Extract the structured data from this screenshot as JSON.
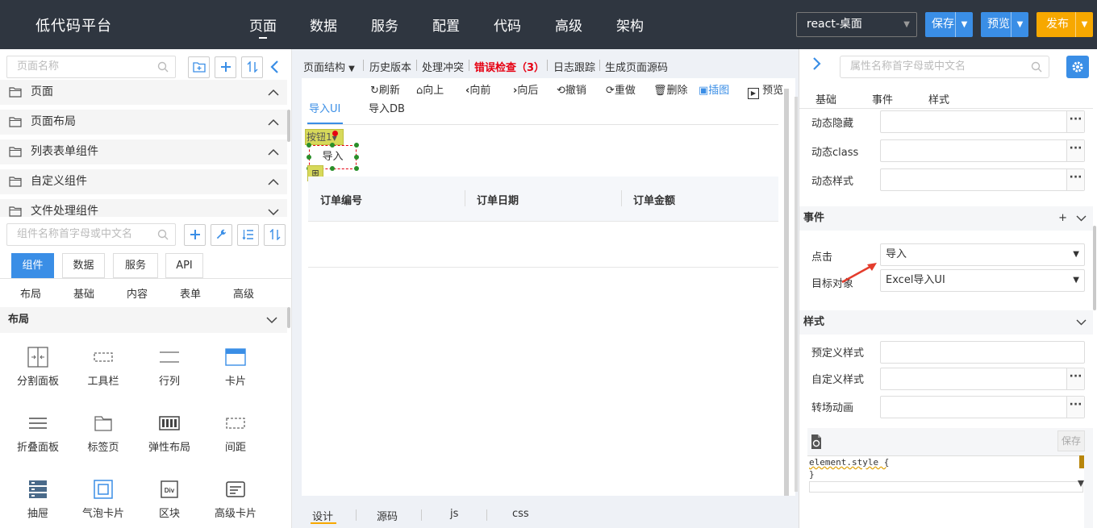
{
  "app": {
    "title": "低代码平台"
  },
  "nav": [
    "页面",
    "数据",
    "服务",
    "配置",
    "代码",
    "高级",
    "架构"
  ],
  "env_select": "react-桌面",
  "buttons": {
    "save": "保存",
    "preview": "预览",
    "publish": "发布"
  },
  "colors": {
    "topbar": "#2f3640",
    "accent": "#3a8ee6",
    "publish": "#f7a800",
    "error": "#e60012",
    "arrow": "#e43c2c"
  },
  "left": {
    "page_search_placeholder": "页面名称",
    "categories": [
      "页面",
      "页面布局",
      "列表表单组件",
      "自定义组件",
      "文件处理组件"
    ],
    "comp_search_placeholder": "组件名称首字母或中文名",
    "tabs": [
      "组件",
      "数据",
      "服务",
      "API"
    ],
    "subtabs": [
      "布局",
      "基础",
      "内容",
      "表单",
      "高级"
    ],
    "section_title": "布局",
    "components": [
      {
        "label": "分割面板",
        "icon": "split-panel-icon"
      },
      {
        "label": "工具栏",
        "icon": "toolbar-icon"
      },
      {
        "label": "行列",
        "icon": "row-col-icon"
      },
      {
        "label": "卡片",
        "icon": "card-icon"
      },
      {
        "label": "折叠面板",
        "icon": "collapse-icon"
      },
      {
        "label": "标签页",
        "icon": "tabs-icon"
      },
      {
        "label": "弹性布局",
        "icon": "flex-icon"
      },
      {
        "label": "间距",
        "icon": "spacing-icon"
      },
      {
        "label": "抽屉",
        "icon": "drawer-icon"
      },
      {
        "label": "气泡卡片",
        "icon": "popover-icon"
      },
      {
        "label": "区块",
        "icon": "div-icon"
      },
      {
        "label": "高级卡片",
        "icon": "advanced-card-icon"
      }
    ]
  },
  "center": {
    "toolbar": {
      "structure": "页面结构",
      "history": "历史版本",
      "conflict": "处理冲突",
      "error": "错误检查（3）",
      "log": "日志跟踪",
      "gen": "生成页面源码"
    },
    "tools": [
      "刷新",
      "向上",
      "向前",
      "向后",
      "撤销",
      "重做",
      "删除",
      "插图",
      "预览"
    ],
    "canvas_tabs": [
      "导入UI",
      "导入DB"
    ],
    "button_group_label": "按钮1",
    "import_button": "导入",
    "table_headers": [
      "订单编号",
      "订单日期",
      "订单金额"
    ],
    "bottom_tabs": [
      "设计",
      "源码",
      "js",
      "css"
    ]
  },
  "right": {
    "search_placeholder": "属性名称首字母或中文名",
    "tabs": [
      "基础",
      "事件",
      "样式"
    ],
    "props_top": [
      "动态隐藏",
      "动态class",
      "动态样式"
    ],
    "events_section": "事件",
    "events_add": "+",
    "click_label": "点击",
    "click_value": "导入",
    "target_label": "目标对象",
    "target_value": "Excel导入UI",
    "style_section": "样式",
    "style_props": [
      "预定义样式",
      "自定义样式",
      "转场动画"
    ],
    "code_save": "保存",
    "code_line1": "element.style {",
    "code_line2": "}"
  }
}
